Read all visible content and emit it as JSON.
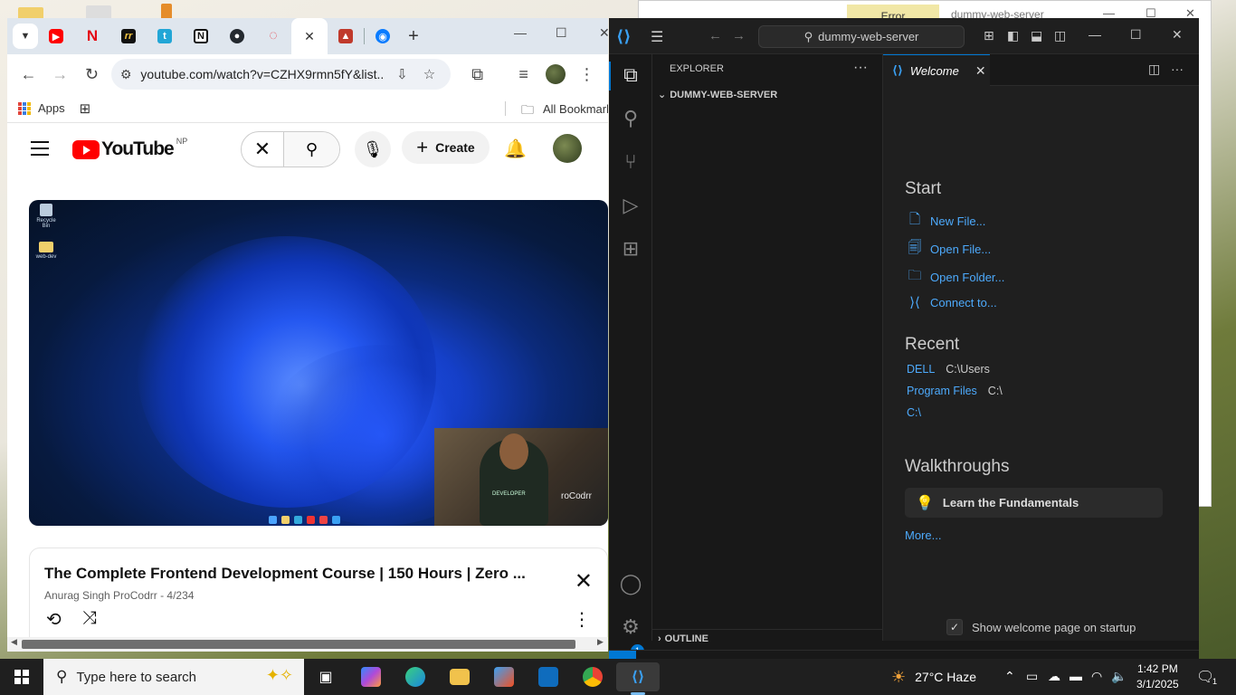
{
  "background_window": {
    "error_tab": "Error",
    "title": "dummy-web-server"
  },
  "chrome": {
    "tabs": [
      {
        "icon": "youtube-icon",
        "color": "#ff0000"
      },
      {
        "icon": "netflix-icon",
        "color": "#e50914",
        "glyph": "N"
      },
      {
        "icon": "app-icon",
        "color": "#222222",
        "glyph": "rr"
      },
      {
        "icon": "typing-icon",
        "color": "#22a6d6",
        "glyph": "t"
      },
      {
        "icon": "notion-icon",
        "color": "#111111",
        "glyph": "N"
      },
      {
        "icon": "github-icon",
        "color": "#24292f",
        "glyph": "●"
      },
      {
        "icon": "loading-icon",
        "color": "#e4535c",
        "glyph": "◌"
      },
      {
        "icon": "active-tab-close-icon",
        "active": true
      },
      {
        "icon": "site-icon",
        "color": "#c0392b",
        "glyph": "▲"
      },
      {
        "icon": "messenger-icon",
        "color": "#0a7cff",
        "glyph": "◉"
      }
    ],
    "url": "youtube.com/watch?v=CZHX9rmn5fY&list...",
    "bookmarks": {
      "apps": "Apps",
      "all_bookmarks": "All Bookmarks"
    }
  },
  "youtube": {
    "logo_text": "YouTube",
    "country_code": "NP",
    "create_label": "Create",
    "player": {
      "desktop_icons": [
        "Recycle Bin",
        "web-dev"
      ],
      "webcam_shirt": "DEVELOPER",
      "webcam_brand": "roCodrr"
    },
    "playlist": {
      "title": "The Complete Frontend Development Course | 150 Hours | Zero ...",
      "subtitle": "Anurag Singh ProCodrr - 4/234"
    }
  },
  "vscode": {
    "command_center": "dummy-web-server",
    "explorer_header": "EXPLORER",
    "folder": "DUMMY-WEB-SERVER",
    "outline": "OUTLINE",
    "welcome_tab": "Welcome",
    "start_heading": "Start",
    "start_links": [
      {
        "label": "New File...",
        "icon": "new-file-icon",
        "glyph": "🗋"
      },
      {
        "label": "Open File...",
        "icon": "open-file-icon",
        "glyph": "🗐"
      },
      {
        "label": "Open Folder...",
        "icon": "open-folder-icon",
        "glyph": "🗀"
      },
      {
        "label": "Connect to...",
        "icon": "remote-connect-icon",
        "glyph": "⟩⟨"
      }
    ],
    "recent_heading": "Recent",
    "recent": [
      {
        "name": "DELL",
        "path": "C:\\Users"
      },
      {
        "name": "Program Files",
        "path": "C:\\"
      },
      {
        "name": "C:\\",
        "path": ""
      }
    ],
    "walkthroughs_heading": "Walkthroughs",
    "walkthrough_item": "Learn the Fundamentals",
    "more_link": "More...",
    "show_on_startup": "Show welcome page on startup",
    "show_on_startup_checked": true,
    "settings_badge": "1"
  },
  "taskbar": {
    "search_placeholder": "Type here to search",
    "weather": "27°C  Haze",
    "time": "1:42 PM",
    "date": "3/1/2025",
    "notification_count": "1"
  }
}
